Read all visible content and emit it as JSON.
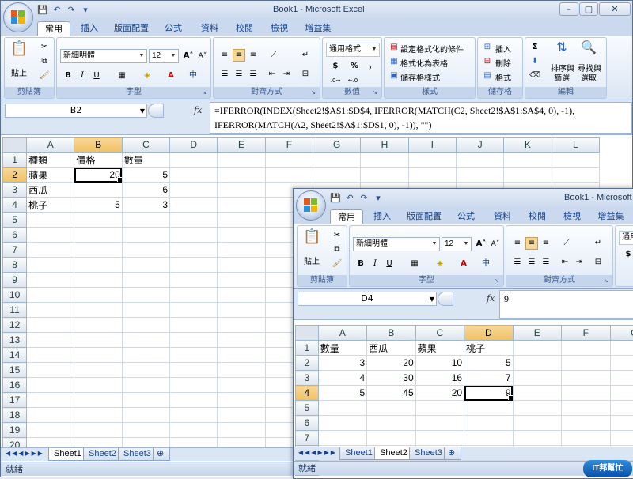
{
  "window1": {
    "title": "Book1 - Microsoft Excel",
    "tabs": [
      "常用",
      "插入",
      "版面配置",
      "公式",
      "資料",
      "校閱",
      "檢視",
      "增益集"
    ],
    "groups": {
      "clipboard": "剪貼簿",
      "font": "字型",
      "alignment": "對齊方式",
      "number": "數值",
      "styles": "樣式",
      "cells": "儲存格",
      "editing": "編輯"
    },
    "paste_label": "貼上",
    "font_name": "新細明體",
    "font_size": "12",
    "number_format": "通用格式",
    "styles": [
      "設定格式化的條件",
      "格式化為表格",
      "儲存格樣式"
    ],
    "cells_buttons": [
      "插入",
      "刪除",
      "格式"
    ],
    "editing": {
      "sort": "排序與",
      "sort2": "篩選",
      "find": "尋找與",
      "find2": "選取"
    },
    "name_box": "B2",
    "formula_line1": "=IFERROR(INDEX(Sheet2!$A$1:$D$4, IFERROR(MATCH(C2, Sheet2!$A$1:$A$4, 0), -1),",
    "formula_line2": "IFERROR(MATCH(A2, Sheet2!$A$1:$D$1, 0), -1)), \"\")",
    "columns": [
      "A",
      "B",
      "C",
      "D",
      "E",
      "F",
      "G",
      "H",
      "I",
      "J",
      "K",
      "L"
    ],
    "rows": [
      [
        "種類",
        "價格",
        "數量"
      ],
      [
        "蘋果",
        "20",
        "5"
      ],
      [
        "西瓜",
        "",
        "6"
      ],
      [
        "桃子",
        "5",
        "3"
      ]
    ],
    "row_count": 20,
    "sheets": [
      "Sheet1",
      "Sheet2",
      "Sheet3"
    ],
    "status": "就緒"
  },
  "window2": {
    "title": "Book1 - Microsoft",
    "tabs": [
      "常用",
      "插入",
      "版面配置",
      "公式",
      "資料",
      "校閱",
      "檢視",
      "增益集"
    ],
    "groups": {
      "clipboard": "剪貼簿",
      "font": "字型",
      "alignment": "對齊方式"
    },
    "paste_label": "貼上",
    "font_name": "新細明體",
    "font_size": "12",
    "number_format": "通用",
    "name_box": "D4",
    "formula": "9",
    "columns": [
      "A",
      "B",
      "C",
      "D",
      "E",
      "F",
      "G"
    ],
    "rows": [
      [
        "數量",
        "西瓜",
        "蘋果",
        "桃子"
      ],
      [
        "3",
        "20",
        "10",
        "5"
      ],
      [
        "4",
        "30",
        "16",
        "7"
      ],
      [
        "5",
        "45",
        "20",
        "9"
      ]
    ],
    "row_count": 9,
    "sheets": [
      "Sheet1",
      "Sheet2",
      "Sheet3"
    ],
    "status": "就緒"
  },
  "watermark": "IT邦幫忙"
}
